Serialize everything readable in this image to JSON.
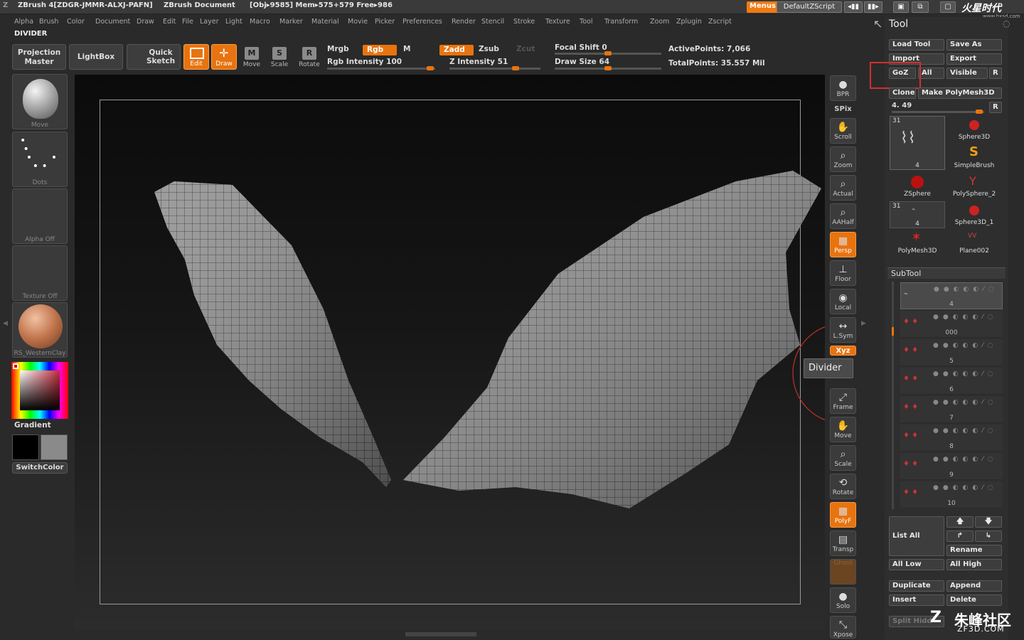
{
  "titlebar": {
    "app": "ZBrush 4[ZDGR-JMMR-ALXJ-PAFN]",
    "doc": "ZBrush Document",
    "stats": "[Obj▸9585] Mem▸575+579 Free▸986",
    "menus": "Menus",
    "script": "DefaultZScript",
    "logo": "火星时代",
    "logo_url": "www.hxsd.com"
  },
  "menubar": [
    "Alpha",
    "Brush",
    "Color",
    "Document",
    "Draw",
    "Edit",
    "File",
    "Layer",
    "Light",
    "Macro",
    "Marker",
    "Material",
    "Movie",
    "Picker",
    "Preferences",
    "Render",
    "Stencil",
    "Stroke",
    "Texture",
    "Tool",
    "Transform",
    "Zoom",
    "Zplugin",
    "Zscript"
  ],
  "panel_title": "DIVIDER",
  "shelf": {
    "projection_master": [
      "Projection",
      "Master"
    ],
    "lightbox": "LightBox",
    "quick_sketch": [
      "Quick",
      "Sketch"
    ],
    "edit": "Edit",
    "draw": "Draw",
    "move": "Move",
    "scale": "Scale",
    "rotate": "Rotate",
    "mrgb": "Mrgb",
    "rgb": "Rgb",
    "m": "M",
    "zadd": "Zadd",
    "zsub": "Zsub",
    "zcut": "Zcut",
    "rgb_intensity": "Rgb Intensity 100",
    "z_intensity": "Z Intensity 51",
    "focal_shift": "Focal Shift 0",
    "draw_size": "Draw Size 64",
    "active_points": "ActivePoints: 7,066",
    "total_points": "TotalPoints: 35.557 Mil"
  },
  "left_tray": {
    "brush": "Move",
    "stroke": "Dots",
    "alpha": "Alpha Off",
    "texture": "Texture Off",
    "material": "RS_WesternClay",
    "gradient": "Gradient",
    "switchcolor": "SwitchColor"
  },
  "right_shelf": [
    "BPR",
    "SPix",
    "Scroll",
    "Zoom",
    "Actual",
    "AAHalf",
    "Persp",
    "Floor",
    "Local",
    "L.Sym",
    "Xyz",
    "Frame",
    "Move",
    "Scale",
    "Rotate",
    "PolyF",
    "Transp",
    "Ghost",
    "Solo",
    "Xpose"
  ],
  "tooltip": "Divider",
  "tool": {
    "title": "Tool",
    "load_tool": "Load Tool",
    "save_as": "Save As",
    "import": "Import",
    "export": "Export",
    "goz": "GoZ",
    "all": "All",
    "visible": "Visible",
    "r": "R",
    "clone": "Clone",
    "make_polymesh": "Make PolyMesh3D",
    "slider_value": "4. 49",
    "thumbs": [
      {
        "name": "",
        "badge": "31",
        "sub": "4"
      },
      {
        "name": "Sphere3D"
      },
      {
        "name": "SimpleBrush"
      },
      {
        "name": "ZSphere"
      },
      {
        "name": "PolySphere_2"
      },
      {
        "name": "",
        "badge": "31",
        "sub": "4"
      },
      {
        "name": "Sphere3D_1"
      },
      {
        "name": "PolyMesh3D"
      },
      {
        "name": "Plane002"
      }
    ]
  },
  "subtool": {
    "title": "SubTool",
    "rows": [
      "4",
      "000",
      "5",
      "6",
      "7",
      "8",
      "9",
      "10"
    ],
    "list_all": "List All",
    "rename": "Rename",
    "all_low": "All Low",
    "all_high": "All High",
    "duplicate": "Duplicate",
    "append": "Append",
    "insert": "Insert",
    "delete": "Delete",
    "split_hidden": "Split Hidd"
  },
  "watermark": {
    "cn": "朱峰社区",
    "url": "ZF3D.COM"
  },
  "colors": {
    "accent": "#e8730f",
    "highlight_box": "#d0312d"
  }
}
